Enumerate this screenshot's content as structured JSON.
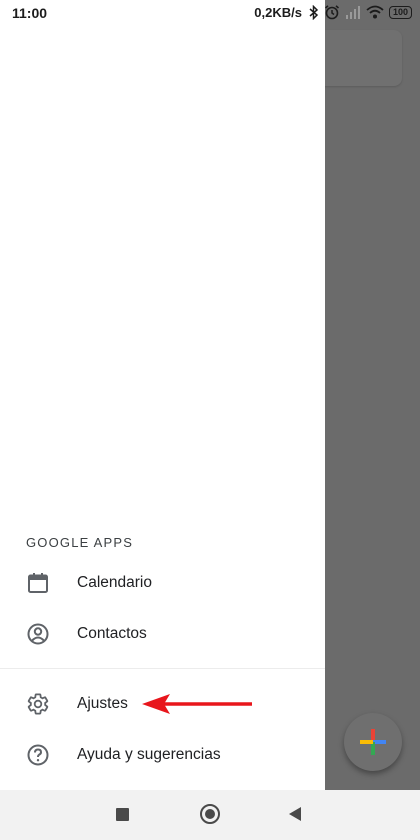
{
  "status_bar": {
    "time": "11:00",
    "network_speed": "0,2KB/s",
    "battery": "100",
    "icons": [
      "bluetooth-icon",
      "alarm-icon",
      "signal-icon",
      "wifi-icon",
      "battery-icon"
    ]
  },
  "drawer": {
    "section_header": "GOOGLE APPS",
    "google_apps": [
      {
        "label": "Calendario",
        "icon": "calendar-icon"
      },
      {
        "label": "Contactos",
        "icon": "account-circle-icon"
      }
    ],
    "footer_items": [
      {
        "label": "Ajustes",
        "icon": "settings-gear-icon"
      },
      {
        "label": "Ayuda y sugerencias",
        "icon": "help-icon"
      }
    ]
  },
  "annotation": {
    "type": "arrow",
    "color": "#e8161c",
    "points_to": "Ajustes"
  },
  "fab": {
    "icon": "plus-icon",
    "colors": [
      "#ea4335",
      "#4285f4",
      "#34a853",
      "#fbbc05"
    ]
  },
  "nav_bar": {
    "buttons": [
      "recents-icon",
      "home-icon",
      "back-icon"
    ]
  }
}
